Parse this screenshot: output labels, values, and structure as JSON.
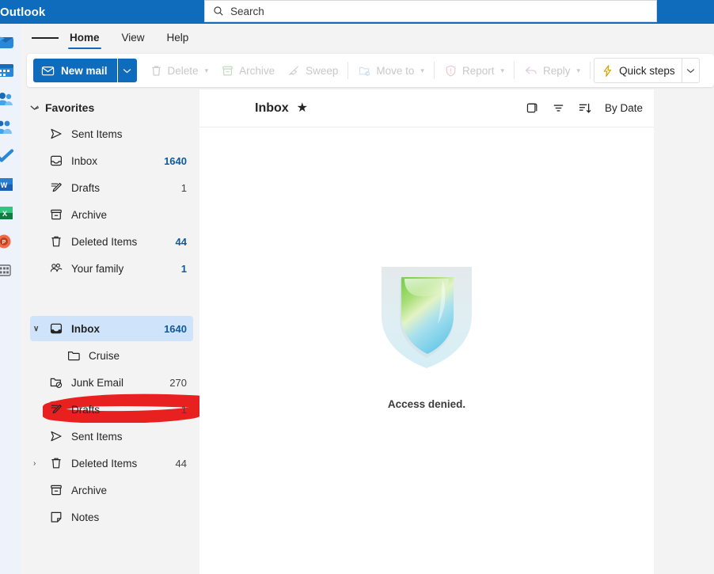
{
  "window": {
    "brand": "Outlook"
  },
  "search": {
    "placeholder": "Search",
    "icon": "search-icon"
  },
  "rail": {
    "items": [
      {
        "name": "mail-app-icon",
        "label": "Mail"
      },
      {
        "name": "calendar-app-icon",
        "label": "Calendar"
      },
      {
        "name": "people-app-icon",
        "label": "People"
      },
      {
        "name": "groups-app-icon",
        "label": "Groups"
      },
      {
        "name": "to-do-app-icon",
        "label": "To Do"
      },
      {
        "name": "word-app-icon",
        "label": "Word"
      },
      {
        "name": "excel-app-icon",
        "label": "Excel"
      },
      {
        "name": "powerpoint-app-icon",
        "label": "PowerPoint"
      },
      {
        "name": "apps-grid-icon",
        "label": "Apps"
      }
    ]
  },
  "ribbon": {
    "tabs": [
      {
        "label": "Home",
        "active": true
      },
      {
        "label": "View",
        "active": false
      },
      {
        "label": "Help",
        "active": false
      }
    ],
    "new_mail": {
      "label": "New mail",
      "icon": "mail-icon",
      "caret": "∨"
    },
    "buttons": [
      {
        "label": "Delete",
        "icon": "trash-icon",
        "enabled": false,
        "caret": true
      },
      {
        "label": "Archive",
        "icon": "archive-icon",
        "enabled": false,
        "caret": false
      },
      {
        "label": "Sweep",
        "icon": "broom-icon",
        "enabled": false,
        "caret": false
      },
      {
        "label": "Move to",
        "icon": "folder-arrow-icon",
        "enabled": false,
        "caret": true
      },
      {
        "label": "Report",
        "icon": "shield-alert-icon",
        "enabled": false,
        "caret": true
      },
      {
        "label": "Reply",
        "icon": "reply-arrow-icon",
        "enabled": false,
        "caret": true
      },
      {
        "label": "Quick steps",
        "icon": "lightning-icon",
        "enabled": true,
        "caret": true
      }
    ]
  },
  "sidebar": {
    "favorites": {
      "label": "Favorites",
      "expanded": true,
      "items": [
        {
          "label": "Sent Items",
          "icon": "send-icon",
          "count": "",
          "accent": false
        },
        {
          "label": "Inbox",
          "icon": "inbox-icon",
          "count": "1640",
          "accent": true
        },
        {
          "label": "Drafts",
          "icon": "drafts-icon",
          "count": "1",
          "accent": false
        },
        {
          "label": "Archive",
          "icon": "archive-icon",
          "count": "",
          "accent": false
        },
        {
          "label": "Deleted Items",
          "icon": "trash-icon",
          "count": "44",
          "accent": true
        },
        {
          "label": "Your family",
          "icon": "people-icon",
          "count": "1",
          "accent": true
        }
      ]
    },
    "account": {
      "redacted": true,
      "redaction_color": "#e82020"
    },
    "folders": [
      {
        "label": "Inbox",
        "icon": "inbox-filled-icon",
        "count": "1640",
        "accent": true,
        "selected": true,
        "twisty": "∨",
        "child": false
      },
      {
        "label": "Cruise",
        "icon": "folder-icon",
        "count": "",
        "accent": false,
        "selected": false,
        "twisty": "",
        "child": true
      },
      {
        "label": "Junk Email",
        "icon": "junk-icon",
        "count": "270",
        "accent": false,
        "selected": false,
        "twisty": "",
        "child": false
      },
      {
        "label": "Drafts",
        "icon": "drafts-icon",
        "count": "1",
        "accent": false,
        "selected": false,
        "twisty": "",
        "child": false
      },
      {
        "label": "Sent Items",
        "icon": "send-icon",
        "count": "",
        "accent": false,
        "selected": false,
        "twisty": "",
        "child": false
      },
      {
        "label": "Deleted Items",
        "icon": "trash-icon",
        "count": "44",
        "accent": false,
        "selected": false,
        "twisty": "›",
        "child": false
      },
      {
        "label": "Archive",
        "icon": "archive-icon",
        "count": "",
        "accent": false,
        "selected": false,
        "twisty": "",
        "child": false
      },
      {
        "label": "Notes",
        "icon": "notes-icon",
        "count": "",
        "accent": false,
        "selected": false,
        "twisty": "",
        "child": false
      }
    ]
  },
  "message_list": {
    "title": "Inbox",
    "favorite_star": "★",
    "tools": [
      {
        "name": "conversation-view-icon"
      },
      {
        "name": "filter-icon"
      },
      {
        "name": "sort-icon"
      }
    ],
    "sort_label": "By Date",
    "empty_state": {
      "illustration": "shield-illustration",
      "message": "Access denied."
    }
  },
  "colors": {
    "brand_blue": "#0f6cbd",
    "selection_blue": "#cfe4fa",
    "count_accent": "#0f5aa0",
    "sidebar_bg": "#f3f3f3",
    "panel_bg": "#ffffff",
    "redaction_red": "#e82020"
  }
}
